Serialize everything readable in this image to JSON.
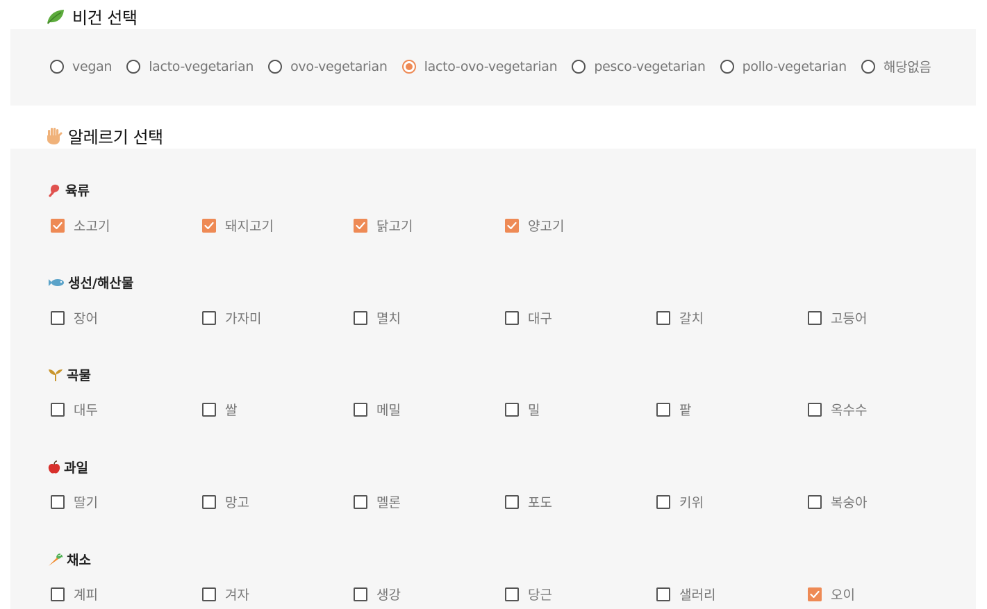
{
  "vegan": {
    "title": "비건 선택",
    "icon": "leaf-icon",
    "options": [
      {
        "label": "vegan",
        "checked": false
      },
      {
        "label": "lacto-vegetarian",
        "checked": false
      },
      {
        "label": "ovo-vegetarian",
        "checked": false
      },
      {
        "label": "lacto-ovo-vegetarian",
        "checked": true
      },
      {
        "label": "pesco-vegetarian",
        "checked": false
      },
      {
        "label": "pollo-vegetarian",
        "checked": false
      },
      {
        "label": "해당없음",
        "checked": false
      }
    ]
  },
  "allergy": {
    "title": "알레르기 선택",
    "icon": "raised-hand-icon",
    "categories": [
      {
        "name": "육류",
        "icon": "meat-icon",
        "items": [
          {
            "label": "소고기",
            "checked": true
          },
          {
            "label": "돼지고기",
            "checked": true
          },
          {
            "label": "닭고기",
            "checked": true
          },
          {
            "label": "양고기",
            "checked": true
          }
        ]
      },
      {
        "name": "생선/해산물",
        "icon": "fish-icon",
        "items": [
          {
            "label": "장어",
            "checked": false
          },
          {
            "label": "가자미",
            "checked": false
          },
          {
            "label": "멸치",
            "checked": false
          },
          {
            "label": "대구",
            "checked": false
          },
          {
            "label": "갈치",
            "checked": false
          },
          {
            "label": "고등어",
            "checked": false
          }
        ]
      },
      {
        "name": "곡물",
        "icon": "sprout-icon",
        "items": [
          {
            "label": "대두",
            "checked": false
          },
          {
            "label": "쌀",
            "checked": false
          },
          {
            "label": "메밀",
            "checked": false
          },
          {
            "label": "밀",
            "checked": false
          },
          {
            "label": "팥",
            "checked": false
          },
          {
            "label": "옥수수",
            "checked": false
          }
        ]
      },
      {
        "name": "과일",
        "icon": "apple-icon",
        "items": [
          {
            "label": "딸기",
            "checked": false
          },
          {
            "label": "망고",
            "checked": false
          },
          {
            "label": "멜론",
            "checked": false
          },
          {
            "label": "포도",
            "checked": false
          },
          {
            "label": "키위",
            "checked": false
          },
          {
            "label": "복숭아",
            "checked": false
          }
        ]
      },
      {
        "name": "채소",
        "icon": "carrot-icon",
        "items": [
          {
            "label": "계피",
            "checked": false
          },
          {
            "label": "겨자",
            "checked": false
          },
          {
            "label": "생강",
            "checked": false
          },
          {
            "label": "당근",
            "checked": false
          },
          {
            "label": "샐러리",
            "checked": false
          },
          {
            "label": "오이",
            "checked": true
          }
        ]
      }
    ]
  },
  "colors": {
    "accent": "#ee8a55",
    "panel": "#f6f6f6"
  }
}
